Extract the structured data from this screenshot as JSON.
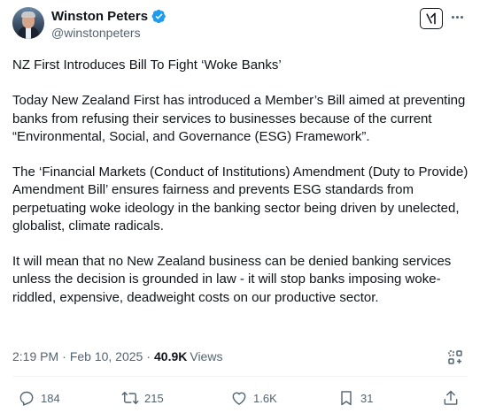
{
  "author": {
    "display_name": "Winston Peters",
    "handle": "@winstonpeters",
    "verified_color": "#1d9bf0"
  },
  "post": {
    "paragraphs": [
      "NZ First Introduces Bill To Fight ‘Woke Banks’",
      "Today New Zealand First has introduced a Member’s Bill aimed at preventing banks from refusing their services to businesses because of the current “Environmental, Social, and Governance (ESG) Framework”.",
      "The ‘Financial Markets (Conduct of Institutions) Amendment (Duty to Provide) Amendment Bill’ ensures fairness and prevents ESG standards from perpetuating woke ideology in the banking sector being driven by unelected, globalist, climate radicals.",
      "It will mean that no New Zealand business can be denied banking services unless the decision is grounded in law - it will stop banks imposing woke-riddled, expensive, deadweight costs on our productive sector."
    ]
  },
  "meta": {
    "time": "2:19 PM",
    "separator": "·",
    "date": "Feb 10, 2025",
    "views_count": "40.9K",
    "views_label": "Views"
  },
  "actions": {
    "replies": "184",
    "reposts": "215",
    "likes": "1.6K",
    "bookmarks": "31"
  },
  "icons": {
    "reply": "reply-icon",
    "repost": "repost-icon",
    "like": "heart-icon",
    "bookmark": "bookmark-icon",
    "share": "share-icon",
    "grok": "grok-icon",
    "more": "more-icon"
  }
}
